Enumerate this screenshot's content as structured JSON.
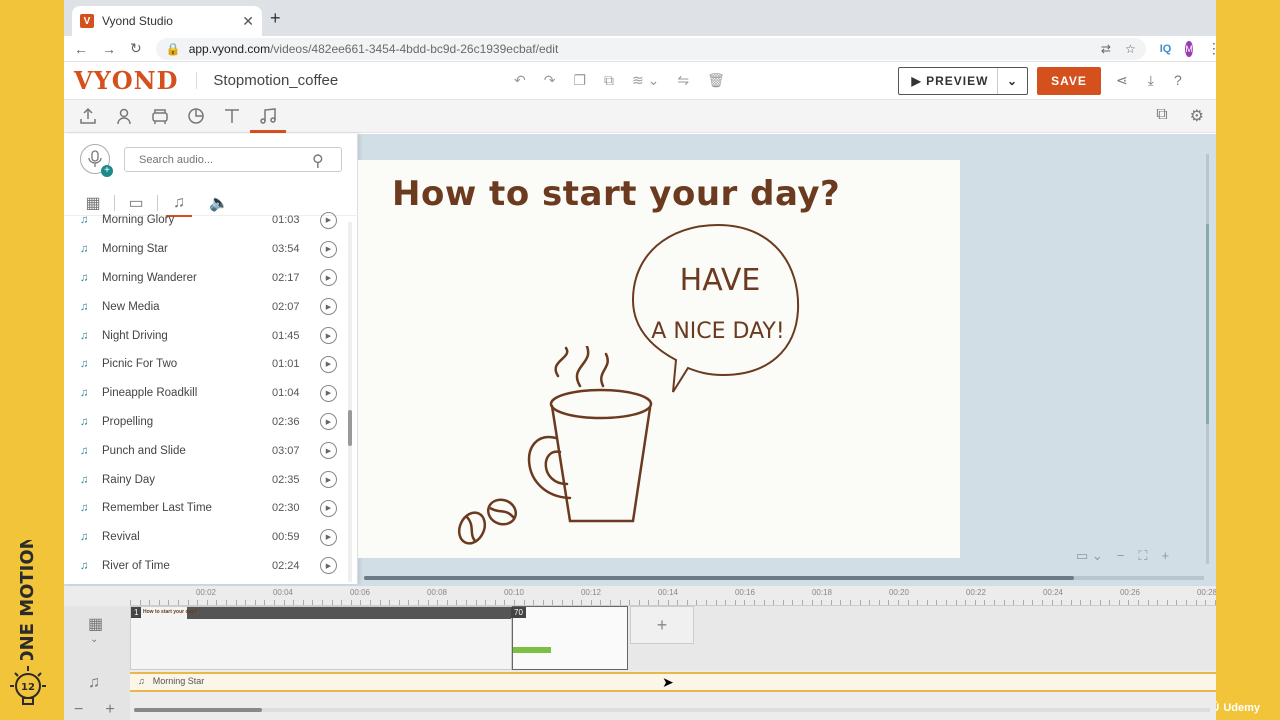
{
  "browser": {
    "tab_title": "Vyond Studio",
    "tab_favicon_letter": "V",
    "url_host": "app.vyond.com",
    "url_path": "/videos/482ee661-3454-4bdd-bc9d-26c1939ecbaf/edit",
    "iq_label": "IQ",
    "profile_initial": "M"
  },
  "app": {
    "logo": "VYOND",
    "project_name": "Stopmotion_coffee",
    "preview_label": "PREVIEW",
    "save_label": "SAVE"
  },
  "audio_panel": {
    "search_placeholder": "Search audio...",
    "tracks": [
      {
        "name": "Morning Glory",
        "duration": "01:03"
      },
      {
        "name": "Morning Star",
        "duration": "03:54"
      },
      {
        "name": "Morning Wanderer",
        "duration": "02:17"
      },
      {
        "name": "New Media",
        "duration": "02:07"
      },
      {
        "name": "Night Driving",
        "duration": "01:45"
      },
      {
        "name": "Picnic For Two",
        "duration": "01:01"
      },
      {
        "name": "Pineapple Roadkill",
        "duration": "01:04"
      },
      {
        "name": "Propelling",
        "duration": "02:36"
      },
      {
        "name": "Punch and Slide",
        "duration": "03:07"
      },
      {
        "name": "Rainy Day",
        "duration": "02:35"
      },
      {
        "name": "Remember Last Time",
        "duration": "02:30"
      },
      {
        "name": "Revival",
        "duration": "00:59"
      },
      {
        "name": "River of Time",
        "duration": "02:24"
      }
    ]
  },
  "stage": {
    "title": "How to start your day?",
    "bubble_line1": "HAVE",
    "bubble_line2": "A NICE DAY!"
  },
  "timeline": {
    "ticks": [
      "00:02",
      "00:04",
      "00:06",
      "00:08",
      "00:10",
      "00:12",
      "00:14",
      "00:16",
      "00:18",
      "00:20",
      "00:22",
      "00:24",
      "00:26",
      "00:28"
    ],
    "scene1_number": "1",
    "scene1_caption": "How to start your day?",
    "scene2_number": "70",
    "audio_track_name": "Morning Star"
  },
  "branding": {
    "side_text": "ONE MOTION",
    "bulb_number": "12",
    "udemy": "Udemy"
  },
  "colors": {
    "accent": "#d4511e",
    "brand_yellow": "#f2c43a",
    "teal": "#1b8a8a",
    "coffee_brown": "#6b3a1f"
  }
}
